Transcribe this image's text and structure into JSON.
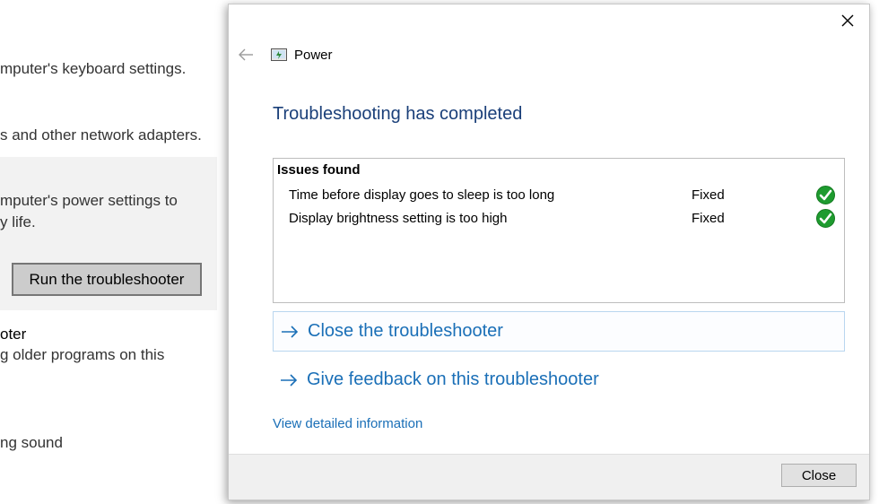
{
  "background": {
    "lines": [
      "mputer's keyboard settings.",
      "s and other network adapters.",
      "mputer's power settings to",
      "y life.",
      "oter",
      "g older programs on this",
      "ng sound"
    ],
    "run_button_label": "Run the troubleshooter"
  },
  "dialog": {
    "title": "Power",
    "heading": "Troubleshooting has completed",
    "issues_title": "Issues found",
    "issues": [
      {
        "text": "Time before display goes to sleep is too long",
        "status": "Fixed"
      },
      {
        "text": "Display brightness setting is too high",
        "status": "Fixed"
      }
    ],
    "close_troubleshooter_label": "Close the troubleshooter",
    "feedback_label": "Give feedback on this troubleshooter",
    "details_link": "View detailed information",
    "close_button_label": "Close"
  },
  "colors": {
    "heading": "#1a3f79",
    "link": "#1a6fb7",
    "check_green": "#1e9b2f"
  },
  "icons": {
    "close": "close-x-icon",
    "back": "back-arrow-icon",
    "power": "power-troubleshooter-icon",
    "check": "green-check-icon",
    "link_arrow": "right-arrow-icon"
  }
}
